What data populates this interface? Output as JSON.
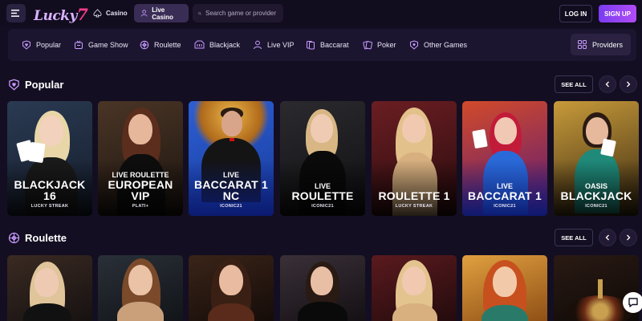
{
  "header": {
    "logo_text": "Lucky",
    "logo_seven": "7",
    "nav": [
      {
        "label": "Casino",
        "icon": "spade-icon"
      },
      {
        "label": "Live Casino",
        "icon": "person-icon",
        "active": true
      }
    ],
    "search_placeholder": "Search game or provider",
    "login_label": "LOG IN",
    "signup_label": "SIGN UP"
  },
  "categories": [
    {
      "label": "Popular",
      "icon": "heart-badge-icon"
    },
    {
      "label": "Game Show",
      "icon": "game-show-icon"
    },
    {
      "label": "Roulette",
      "icon": "roulette-icon"
    },
    {
      "label": "Blackjack",
      "icon": "blackjack-icon"
    },
    {
      "label": "Live VIP",
      "icon": "vip-person-icon"
    },
    {
      "label": "Baccarat",
      "icon": "baccarat-icon"
    },
    {
      "label": "Poker",
      "icon": "poker-icon"
    },
    {
      "label": "Other Games",
      "icon": "other-games-icon"
    }
  ],
  "providers_label": "Providers",
  "sections": [
    {
      "title": "Popular",
      "see_all": "SEE ALL",
      "games": [
        {
          "pre": "",
          "title": "BLACKJACK 16",
          "provider": "LUCKY STREAK"
        },
        {
          "pre": "LIVE ROULETTE",
          "title": "EUROPEAN VIP",
          "provider": "PLATI+"
        },
        {
          "pre": "LIVE",
          "title": "BACCARAT 1 NC",
          "provider": "ICONIC21"
        },
        {
          "pre": "LIVE",
          "title": "ROULETTE",
          "provider": "ICONIC21"
        },
        {
          "pre": "",
          "title": "ROULETTE 1",
          "provider": "LUCKY STREAK"
        },
        {
          "pre": "LIVE",
          "title": "BACCARAT 1",
          "provider": "ICONIC21"
        },
        {
          "pre": "OASIS",
          "title": "BLACKJACK",
          "provider": "ICONIC21"
        }
      ]
    },
    {
      "title": "Roulette",
      "see_all": "SEE ALL",
      "games": []
    }
  ],
  "colors": {
    "background": "#140e22",
    "accent": "#b04cf6",
    "bar": "#1c1530"
  }
}
